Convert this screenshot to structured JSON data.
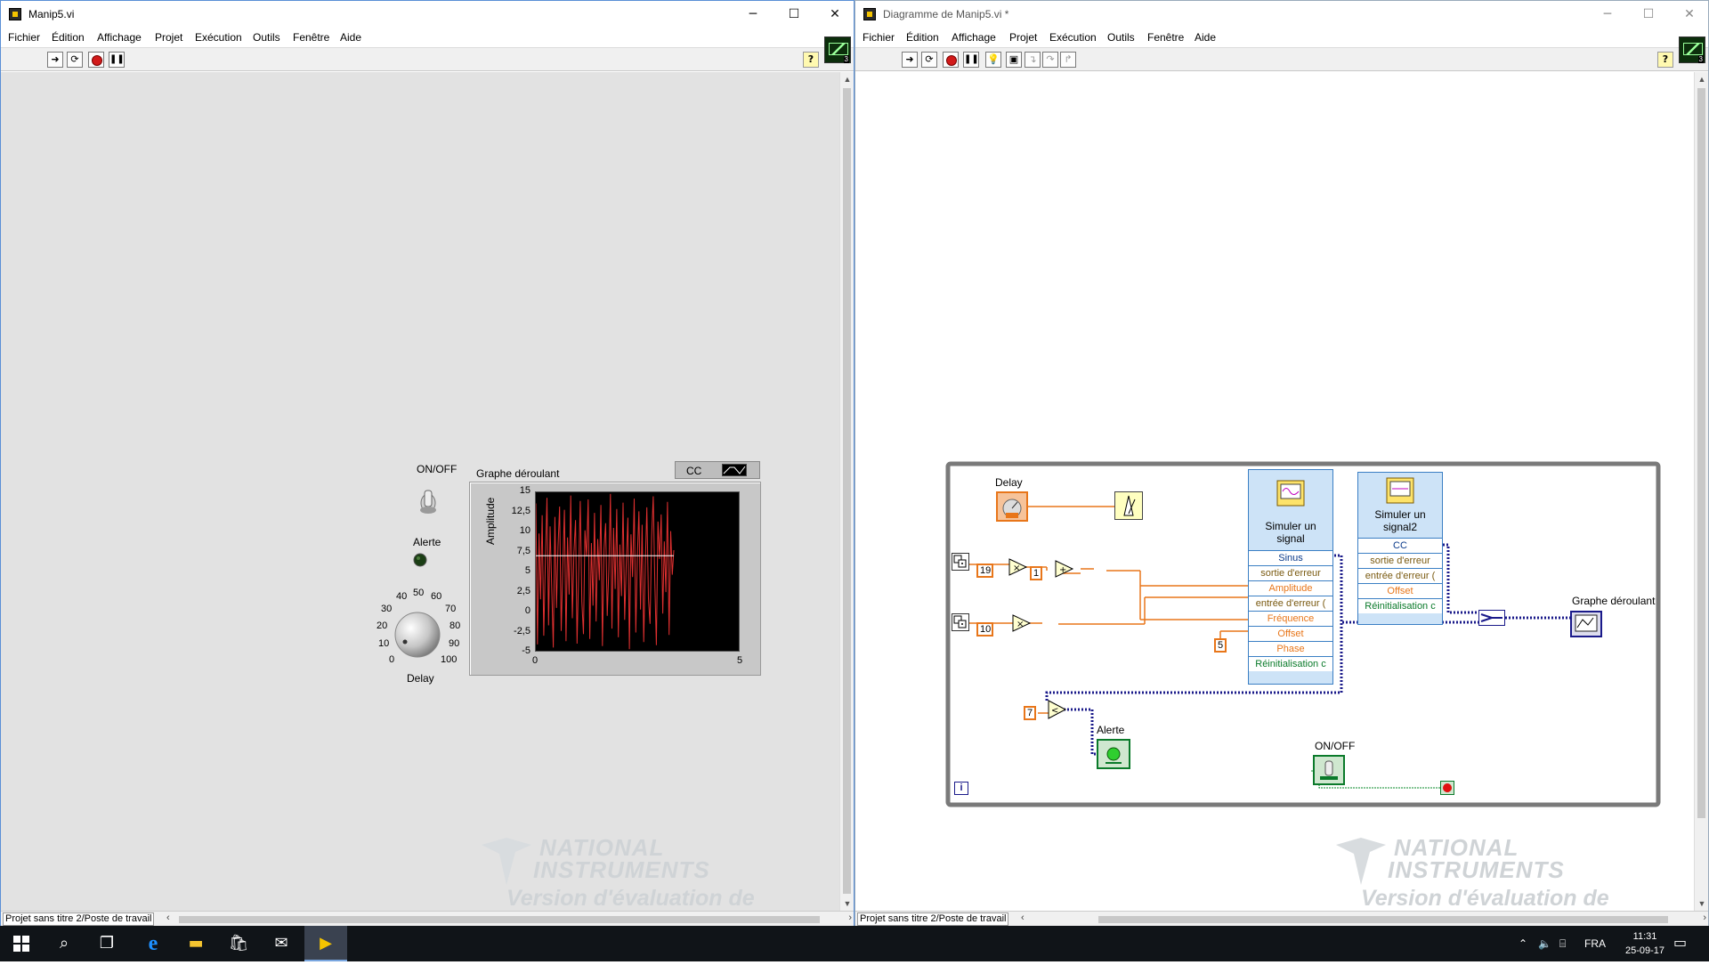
{
  "front": {
    "title": "Manip5.vi",
    "menu": [
      "Fichier",
      "Édition",
      "Affichage",
      "Projet",
      "Exécution",
      "Outils",
      "Fenêtre",
      "Aide"
    ],
    "switch_label": "ON/OFF",
    "led_label": "Alerte",
    "knob_label": "Delay",
    "knob_scale": [
      "0",
      "10",
      "20",
      "30",
      "40",
      "50",
      "60",
      "70",
      "80",
      "90",
      "100"
    ],
    "graph": {
      "title": "Graphe déroulant",
      "legend_label": "CC",
      "ylabel": "Amplitude"
    },
    "status": "Projet sans titre 2/Poste de travail",
    "watermark": {
      "line1": "NATIONAL",
      "line2": "INSTRUMENTS",
      "line3": "Version d'évaluation de LabVIEW"
    }
  },
  "chart_data": {
    "type": "line",
    "title": "Graphe déroulant",
    "xlabel": "",
    "ylabel": "Amplitude",
    "xlim": [
      0,
      5
    ],
    "ylim": [
      -5,
      15
    ],
    "y_ticks": [
      "15",
      "12,5",
      "10",
      "7,5",
      "5",
      "2,5",
      "0",
      "-2,5",
      "-5"
    ],
    "x_ticks": [
      "0",
      "5"
    ],
    "legend": [
      "CC"
    ],
    "series": [
      {
        "name": "CC",
        "color": "#ffffff",
        "values": [
          7,
          7,
          7,
          7,
          7,
          7,
          7,
          7,
          7,
          7,
          7,
          7
        ]
      },
      {
        "color": "#e03030",
        "values": [
          13.6,
          -4.2,
          9.8,
          1.5,
          12.1,
          -3.1,
          6.4,
          14.3,
          -1.8,
          10.7,
          3.2,
          -4.6,
          11.9,
          0.4,
          8.1,
          13.2,
          -2.5,
          5.7,
          12.8,
          -3.8,
          9.3,
          2.1,
          14.6,
          -0.9,
          7.4,
          11.5,
          -4.1,
          4.8,
          13.9,
          1.2,
          -2.9,
          10.2,
          6.9,
          14.1,
          -3.5,
          8.6,
          0.7,
          12.4,
          -1.3,
          9.1,
          3.9,
          13.4,
          -4.4,
          7.8,
          11.1,
          -0.6,
          5.2,
          14.8,
          -2.2,
          10.5,
          2.8,
          12.9,
          -3.3,
          8.4,
          1.9,
          13.7,
          -1.1,
          6.1,
          11.8,
          -4.8,
          9.7,
          4.3,
          14.2,
          -2.7,
          7.1,
          12.6,
          0.2,
          10.9,
          -3.9,
          5.9,
          13.1,
          1.6,
          -1.6,
          9.4,
          14.5,
          3.5,
          -4.3,
          11.3,
          6.6,
          12.2,
          -0.3,
          8.8,
          2.4,
          13.8,
          -3.0,
          10.1,
          4.6,
          7.7
        ]
      }
    ]
  },
  "diagram": {
    "title": "Diagramme de Manip5.vi *",
    "menu": [
      "Fichier",
      "Édition",
      "Affichage",
      "Projet",
      "Exécution",
      "Outils",
      "Fenêtre",
      "Aide"
    ],
    "delay_label": "Delay",
    "const_19": "19",
    "const_1": "1",
    "const_10": "10",
    "const_5": "5",
    "const_7": "7",
    "sim1": {
      "title_line1": "Simuler un",
      "title_line2": "signal",
      "rows": [
        "Sinus",
        "sortie d'erreur",
        "Amplitude",
        "entrée d'erreur (",
        "Fréquence",
        "Offset",
        "Phase",
        "Réinitialisation c"
      ]
    },
    "sim2": {
      "title_line1": "Simuler un",
      "title_line2": "signal2",
      "rows": [
        "CC",
        "sortie d'erreur",
        "entrée d'erreur (",
        "Offset",
        "Réinitialisation c"
      ]
    },
    "graph_label": "Graphe déroulant",
    "alert_label": "Alerte",
    "switch_label": "ON/OFF",
    "iter_label": "i",
    "status": "Projet sans titre 2/Poste de travail",
    "watermark": {
      "line1": "NATIONAL",
      "line2": "INSTRUMENTS",
      "line3": "Version d'évaluation de LabVIEW"
    }
  },
  "taskbar": {
    "lang": "FRA",
    "time": "11:31",
    "date": "25-09-17"
  }
}
